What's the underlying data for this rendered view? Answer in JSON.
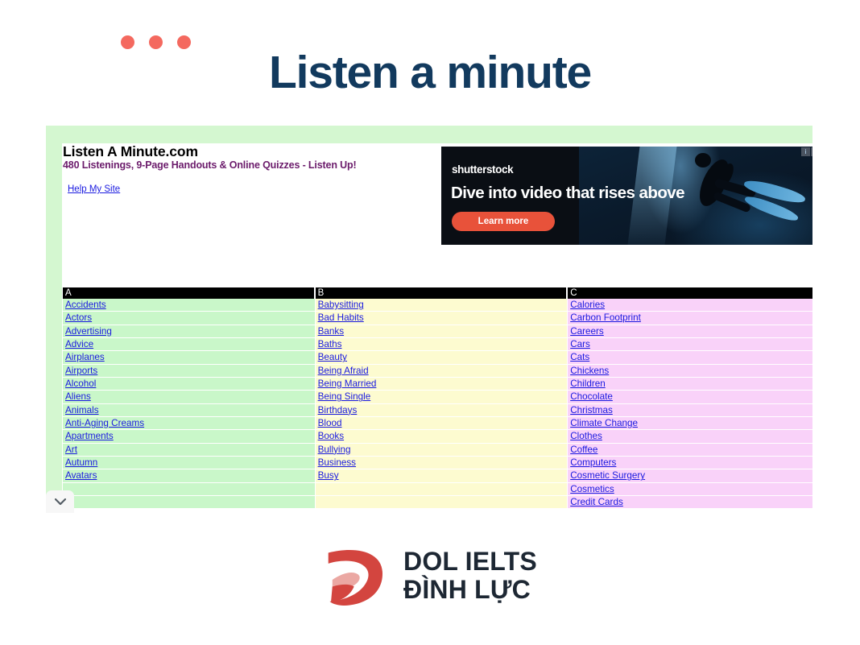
{
  "banner": {
    "title": "Listen a minute",
    "dot_color": "#f4695f",
    "title_color": "#123a5e",
    "dots": [
      "dot",
      "dot",
      "dot"
    ]
  },
  "site": {
    "title": "Listen A Minute.com",
    "tagline": "480 Listenings, 9-Page Handouts & Online Quizzes - Listen Up!",
    "help_link": "Help My Site",
    "frame_color": "#d4f7d0"
  },
  "ad": {
    "brand": "shutterstock",
    "headline": "Dive into video that rises above",
    "cta": "Learn more",
    "cta_color": "#e8523a",
    "info_icon": "i",
    "close_icon": "x"
  },
  "table": {
    "columns": [
      {
        "header": "A",
        "color": "#c9f7c9",
        "items": [
          "Accidents",
          "Actors",
          "Advertising",
          "Advice",
          "Airplanes",
          "Airports",
          "Alcohol",
          "Aliens",
          "Animals",
          "Anti-Aging Creams",
          "Apartments",
          "Art",
          "Autumn",
          "Avatars",
          "",
          ""
        ]
      },
      {
        "header": "B",
        "color": "#fdfbd0",
        "items": [
          "Babysitting",
          "Bad Habits",
          "Banks",
          "Baths",
          "Beauty",
          "Being Afraid",
          "Being Married",
          "Being Single",
          "Birthdays",
          "Blood",
          "Books",
          "Bullying",
          "Business",
          "Busy",
          "",
          ""
        ]
      },
      {
        "header": "C",
        "color": "#f9d2f9",
        "items": [
          "Calories",
          "Carbon Footprint",
          "Careers",
          "Cars",
          "Cats",
          "Chickens",
          "Children",
          "Chocolate",
          "Christmas",
          "Climate Change",
          "Clothes",
          "Coffee",
          "Computers",
          "Cosmetic Surgery",
          "Cosmetics",
          "Credit Cards"
        ]
      }
    ]
  },
  "footer": {
    "logo_line1": "DOL IELTS",
    "logo_line2": "ĐÌNH LỰC",
    "logo_color": "#d3453f"
  }
}
